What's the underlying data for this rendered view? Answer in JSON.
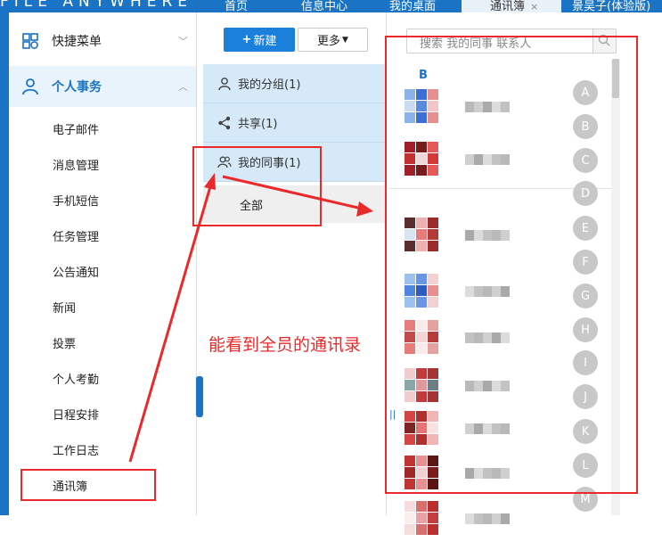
{
  "app": {
    "brand": "FILE ANYWHERE"
  },
  "tabs": [
    {
      "label": "首页"
    },
    {
      "label": "信息中心"
    },
    {
      "label": "我的桌面"
    },
    {
      "label": "通讯簿",
      "active": true,
      "close": "×"
    },
    {
      "label": "景吴子(体验版)"
    }
  ],
  "sidebar": {
    "menus": [
      {
        "label": "快捷菜单",
        "icon": "grid-icon",
        "chevron": "﹀",
        "active": false
      },
      {
        "label": "个人事务",
        "icon": "person-icon",
        "chevron": "︿",
        "active": true
      }
    ],
    "sub_items": [
      "电子邮件",
      "消息管理",
      "手机短信",
      "任务管理",
      "公告通知",
      "新闻",
      "投票",
      "个人考勤",
      "日程安排",
      "工作日志",
      "通讯簿"
    ]
  },
  "middle": {
    "new_button": "新建",
    "more_button": "更多",
    "groups": [
      {
        "label": "我的分组(1)",
        "icon": "person-icon"
      },
      {
        "label": "共享(1)",
        "icon": "share-icon"
      },
      {
        "label": "我的同事(1)",
        "icon": "people-icon"
      }
    ],
    "all_label": "全部"
  },
  "right": {
    "search_placeholder": "搜索 我的同事 联系人",
    "section_letter": "B",
    "index_letters": [
      "A",
      "B",
      "C",
      "D",
      "E",
      "F",
      "G",
      "H",
      "I",
      "J",
      "K",
      "L",
      "M"
    ]
  },
  "annotation": {
    "text": "能看到全员的通讯录"
  },
  "colors": {
    "brand_blue": "#1a73c5",
    "annotation_red": "#ea2a2a",
    "selected_bg": "#d6e9f8"
  }
}
